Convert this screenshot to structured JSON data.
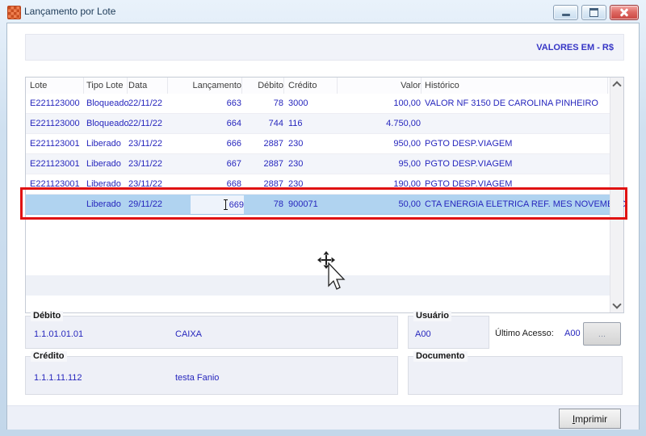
{
  "window": {
    "title": "Lançamento por Lote",
    "valores_label": "VALORES EM - R$"
  },
  "icons": {
    "app_icon": "orange-checker-grid",
    "minimize": "dash",
    "maximize": "square",
    "close": "x",
    "scroll_up": "chevron-up",
    "scroll_down": "chevron-down",
    "mouse": "move-arrow-pointer",
    "text_cursor": "i-beam"
  },
  "table": {
    "columns": [
      "Lote",
      "Tipo Lote",
      "Data",
      "Lançamento",
      "Débito",
      "Crédito",
      "Valor",
      "Histórico"
    ],
    "rows": [
      {
        "lote": "E221123000",
        "tipo_lote": "Bloqueado",
        "data": "22/11/22",
        "lancamento": "663",
        "debito": "78",
        "credito": "3000",
        "valor": "100,00",
        "historico": "VALOR NF 3150 DE CAROLINA PINHEIRO",
        "selected": false,
        "editing": false
      },
      {
        "lote": "E221123000",
        "tipo_lote": "Bloqueado",
        "data": "22/11/22",
        "lancamento": "664",
        "debito": "744",
        "credito": "116",
        "valor": "4.750,00",
        "historico": "",
        "selected": false,
        "editing": false
      },
      {
        "lote": "E221123001",
        "tipo_lote": "Liberado",
        "data": "23/11/22",
        "lancamento": "666",
        "debito": "2887",
        "credito": "230",
        "valor": "950,00",
        "historico": "PGTO DESP.VIAGEM",
        "selected": false,
        "editing": false
      },
      {
        "lote": "E221123001",
        "tipo_lote": "Liberado",
        "data": "23/11/22",
        "lancamento": "667",
        "debito": "2887",
        "credito": "230",
        "valor": "95,00",
        "historico": "PGTO DESP.VIAGEM",
        "selected": false,
        "editing": false
      },
      {
        "lote": "E221123001",
        "tipo_lote": "Liberado",
        "data": "23/11/22",
        "lancamento": "668",
        "debito": "2887",
        "credito": "230",
        "valor": "190,00",
        "historico": "PGTO DESP.VIAGEM",
        "selected": false,
        "editing": false
      },
      {
        "lote": "",
        "tipo_lote": "Liberado",
        "data": "29/11/22",
        "lancamento": "669",
        "debito": "78",
        "credito": "900071",
        "valor": "50,00",
        "historico": "CTA ENERGIA ELETRICA REF. MES NOVEMBRO",
        "selected": true,
        "editing": true
      }
    ]
  },
  "details": {
    "debito": {
      "legend": "Débito",
      "account": "1.1.01.01.01",
      "name": "CAIXA"
    },
    "credito": {
      "legend": "Crédito",
      "account": "1.1.1.11.112",
      "name": "testa Fanio"
    },
    "usuario": {
      "legend": "Usuário",
      "value": "A00"
    },
    "ultimo_acesso": {
      "label": "Último Acesso:",
      "value": "A00",
      "button_label": "..."
    },
    "documento": {
      "legend": "Documento"
    }
  },
  "footer": {
    "imprimir_label": "Imprimir"
  },
  "colors": {
    "data_text_blue": "#2626bd",
    "selection_blue": "#b0d3f0",
    "annotation_red": "#e01212",
    "close_button_red": "#c94540",
    "group_fill": "#eef0f7",
    "titlebar_blue": "#cfe0f0"
  }
}
